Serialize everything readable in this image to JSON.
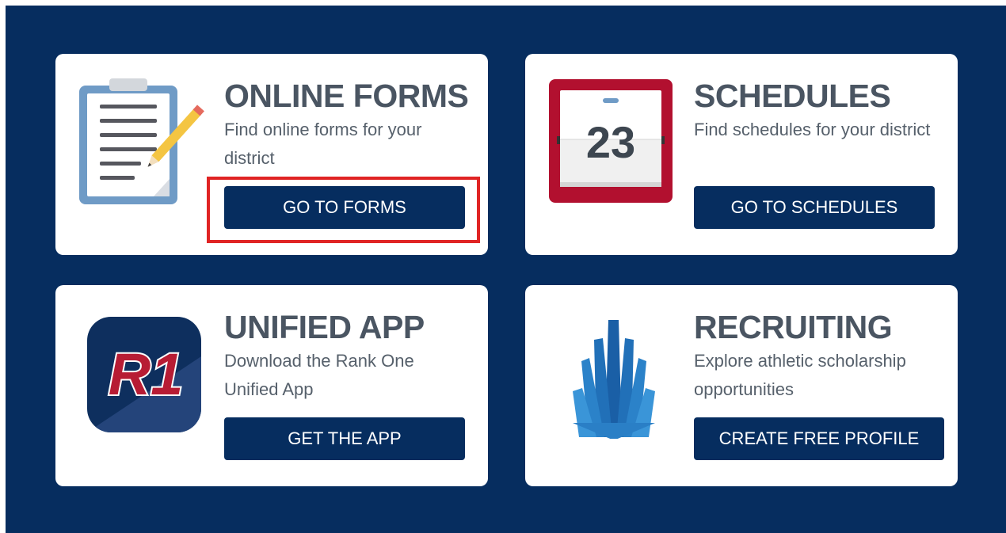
{
  "cards": {
    "forms": {
      "title": "ONLINE FORMS",
      "description": "Find online forms for your district",
      "button_label": "GO TO FORMS",
      "icon": "clipboard-icon"
    },
    "schedules": {
      "title": "SCHEDULES",
      "description": "Find schedules for your district",
      "button_label": "GO TO SCHEDULES",
      "icon": "calendar-icon",
      "calendar_day": "23"
    },
    "app": {
      "title": "UNIFIED APP",
      "description": "Download the Rank One Unified App",
      "button_label": "GET THE APP",
      "icon": "rank-one-app-icon",
      "logo_text": "R1"
    },
    "recruiting": {
      "title": "RECRUITING",
      "description": "Explore athletic scholarship opportunities",
      "button_label": "CREATE FREE PROFILE",
      "icon": "recruiting-icon"
    }
  },
  "colors": {
    "panel_background": "#062d5f",
    "button_background": "#062d5f",
    "title_text": "#4a5562",
    "highlight_border": "#e02424"
  }
}
